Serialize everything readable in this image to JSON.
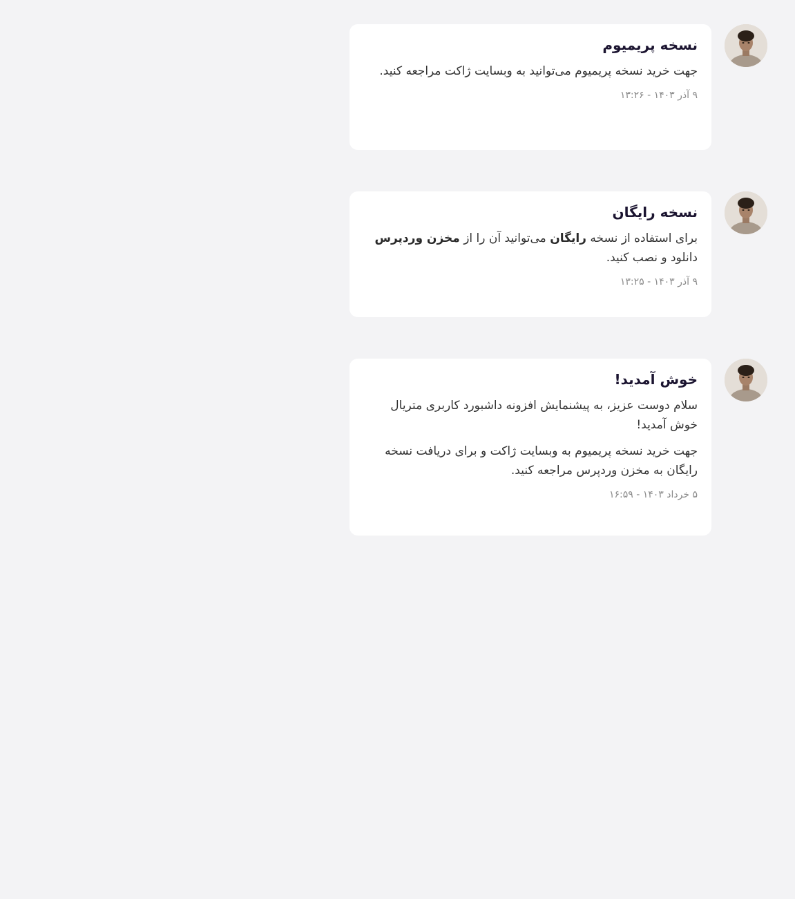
{
  "notifications": [
    {
      "title": "نسخه پریمیوم",
      "body": "جهت خرید نسخه پریمیوم می‌توانید به وبسایت ژاکت مراجعه کنید.",
      "time": "۹ آذر ۱۴۰۳ - ۱۳:۲۶"
    },
    {
      "title": "نسخه رایگان",
      "body_parts": {
        "p1": "برای استفاده از نسخه ",
        "p2": "رایگان",
        "p3": " می‌توانید آن را از ",
        "p4": "مخزن وردپرس",
        "p5": " دانلود و نصب کنید."
      },
      "time": "۹ آذر ۱۴۰۳ - ۱۳:۲۵"
    },
    {
      "title": "خوش آمدید!",
      "body": "سلام دوست عزیز، به پیشنمایش افزونه داشبورد کاربری متریال خوش آمدید!",
      "body2": "جهت خرید نسخه پریمیوم به وبسایت ژاکت و برای دریافت نسخه رایگان به مخزن وردپرس مراجعه کنید.",
      "time": "۵ خرداد ۱۴۰۳ - ۱۶:۵۹"
    }
  ]
}
